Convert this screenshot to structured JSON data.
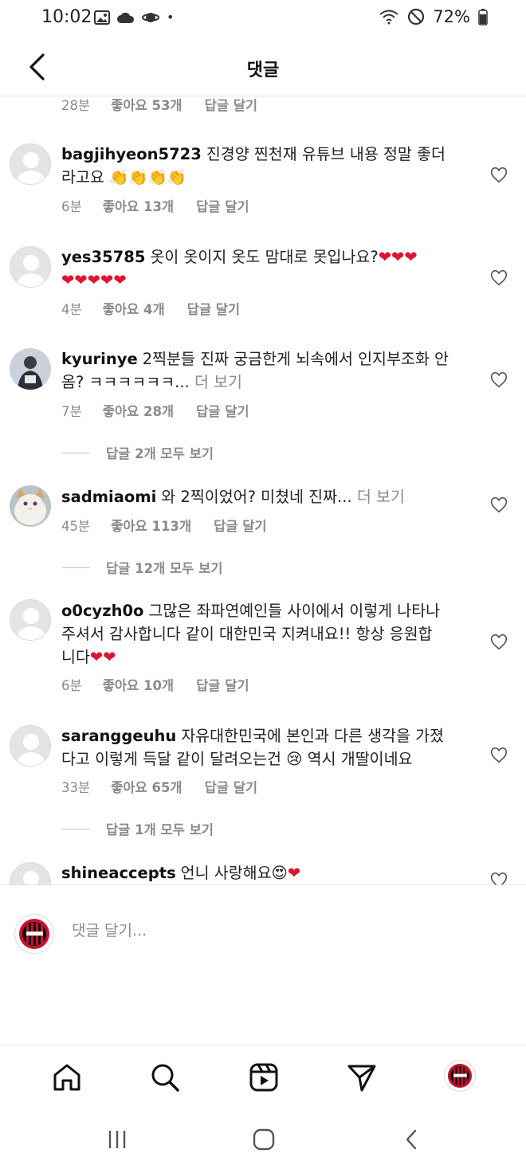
{
  "status_bar": {
    "time": "10:02",
    "battery": "72%",
    "dot": "•"
  },
  "header": {
    "title": "댓글"
  },
  "top_partial": {
    "time": "28분",
    "likes": "좋아요 53개",
    "reply": "답글 달기"
  },
  "comments": [
    {
      "username": "bagjihyeon5723",
      "text_line1": "진경양 찐천재 유튜브 내용 정말 좋더",
      "text_line2": "라고요 👏👏👏👏",
      "time": "6분",
      "likes": "좋아요 13개",
      "reply": "답글 달기"
    },
    {
      "username": "yes35785",
      "text_line1": "옷이 옷이지 옷도 맘대로 못입나요?❤❤❤",
      "text_line2": "❤❤❤❤❤",
      "time": "4분",
      "likes": "좋아요 4개",
      "reply": "답글 달기"
    },
    {
      "username": "kyurinye",
      "text_line1": "2찍분들 진짜 궁금한게 뇌속에서 인지부조화 안",
      "text_line2": "옴? ㅋㅋㅋㅋㅋㅋ...",
      "more": "더 보기",
      "time": "7분",
      "likes": "좋아요 28개",
      "reply": "답글 달기",
      "view_replies": "답글 2개 모두 보기"
    },
    {
      "username": "sadmiaomi",
      "text_line1": "와 2찍이었어? 미쳤네 진짜...",
      "more": "더 보기",
      "time": "45분",
      "likes": "좋아요 113개",
      "reply": "답글 달기",
      "view_replies": "답글 12개 모두 보기"
    },
    {
      "username": "o0cyzh0o",
      "text_line1": "그많은 좌파연예인들 사이에서 이렇게 나타나",
      "text_line2": "주셔서 감사합니다 같이 대한민국 지켜내요!! 항상 응원합",
      "text_line3": "니다❤❤",
      "time": "6분",
      "likes": "좋아요 10개",
      "reply": "답글 달기"
    },
    {
      "username": "saranggeuhu",
      "text_line1": "자유대한민국에 본인과 다른 생각을 가졌",
      "text_line2": "다고 이렇게 득달 같이 달려오는건 😢 역시 개딸이네요",
      "time": "33분",
      "likes": "좋아요 65개",
      "reply": "답글 달기",
      "view_replies": "답글 1개 모두 보기"
    },
    {
      "username": "shineaccepts",
      "text_line1": "언니 사랑해요😍❤"
    }
  ],
  "input": {
    "placeholder": "댓글 달기..."
  },
  "nav": {
    "icons": [
      "home-icon",
      "search-icon",
      "reels-icon",
      "direct-icon",
      "profile-icon"
    ]
  },
  "colors": {
    "text": "#111111",
    "muted": "#8a8a8a",
    "heart_emoji": "#e0142f",
    "acmilan_red": "#c8102e"
  }
}
